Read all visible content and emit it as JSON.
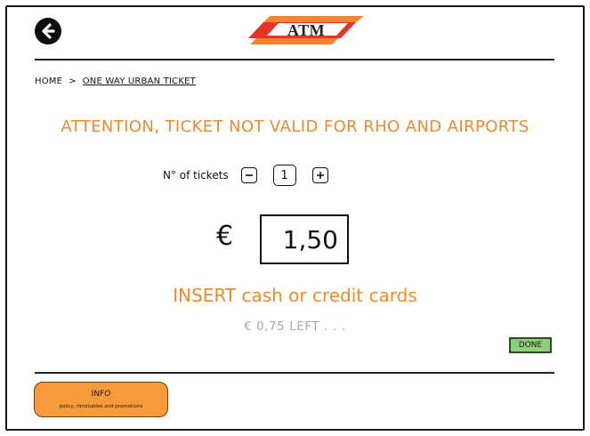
{
  "header": {
    "back_icon": "arrow-left-icon",
    "logo_text": "ATM",
    "colors": {
      "logo_red": "#e8322a",
      "logo_orange": "#f2842d"
    }
  },
  "breadcrumb": {
    "home": "HOME",
    "separator": ">",
    "current": "ONE WAY URBAN TICKET"
  },
  "warning": "ATTENTION, TICKET NOT VALID FOR RHO AND AIRPORTS",
  "quantity": {
    "label": "N° of tickets",
    "decrement_icon": "minus-icon",
    "value": "1",
    "increment_icon": "plus-icon"
  },
  "price": {
    "currency_symbol": "€",
    "amount": "1,50"
  },
  "payment": {
    "instruction": "INSERT cash or credit cards",
    "remaining": "€ 0,75 LEFT . . ."
  },
  "done_label": "DONE",
  "info": {
    "title": "INFO",
    "subtitle": "policy, timetables and promotions"
  },
  "colors": {
    "accent_orange": "#ec8a2e",
    "info_button": "#f79a3a",
    "done_button": "#8fce7a",
    "muted_text": "#a6a6a6"
  }
}
